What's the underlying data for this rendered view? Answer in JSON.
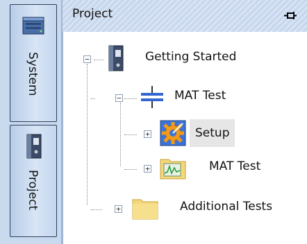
{
  "tabs": [
    {
      "label": "System",
      "icon": "server-icon"
    },
    {
      "label": "Project",
      "icon": "binder-icon"
    }
  ],
  "panel": {
    "title": "Project"
  },
  "tree": {
    "root": {
      "label": "Getting Started",
      "expander": "−"
    },
    "mat_test": {
      "label": "MAT Test",
      "expander": "−"
    },
    "setup": {
      "label": "Setup",
      "expander": "+"
    },
    "mat_test_child": {
      "label": "MAT Test",
      "expander": "+"
    },
    "additional": {
      "label": "Additional Tests",
      "expander": "+"
    }
  },
  "colors": {
    "tab_strip": "#c9d9ee",
    "title_bar": "#c6d6ec",
    "selection": "#e6e6e6"
  }
}
